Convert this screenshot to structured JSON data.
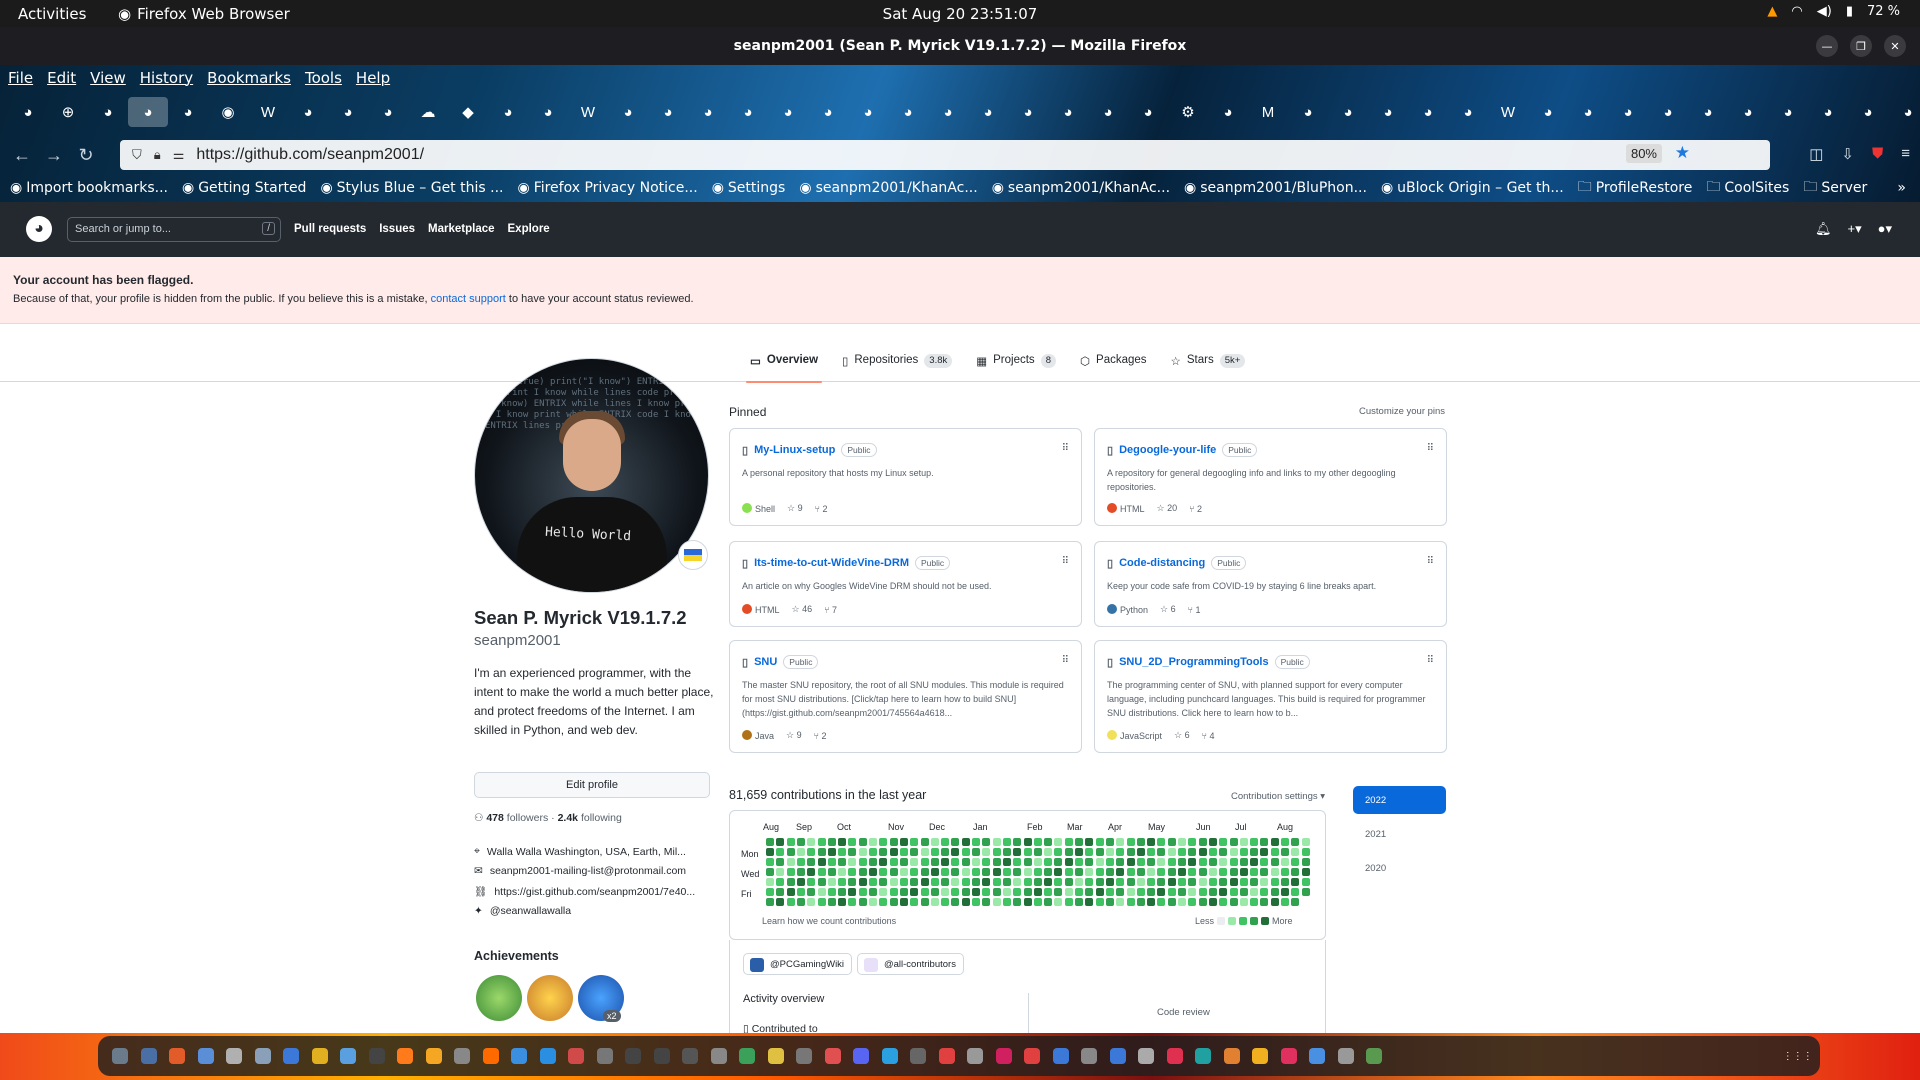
{
  "gnome": {
    "activities": "Activities",
    "app": "Firefox Web Browser",
    "clock": "Sat Aug 20  23:51:07",
    "battery": "72 %"
  },
  "window": {
    "title": "seanpm2001 (Sean P. Myrick V19.1.7.2) — Mozilla Firefox"
  },
  "menu": [
    "File",
    "Edit",
    "View",
    "History",
    "Bookmarks",
    "Tools",
    "Help"
  ],
  "tabs": {
    "count": 48,
    "active_index": 3
  },
  "url": {
    "value": "https://github.com/seanpm2001/",
    "zoom": "80%"
  },
  "bookmarks": [
    "Import bookmarks...",
    "Getting Started",
    "Stylus Blue – Get this ...",
    "Firefox Privacy Notice...",
    "Settings",
    "seanpm2001/KhanAc...",
    "seanpm2001/KhanAc...",
    "seanpm2001/BluPhon...",
    "uBlock Origin – Get th...",
    "ProfileRestore",
    "CoolSites",
    "Server"
  ],
  "github": {
    "search_placeholder": "Search or jump to...",
    "search_key": "/",
    "nav": [
      "Pull requests",
      "Issues",
      "Marketplace",
      "Explore"
    ]
  },
  "flag": {
    "title": "Your account has been flagged.",
    "text_before": "Because of that, your profile is hidden from the public. If you believe this is a mistake,",
    "link": "contact support",
    "text_after": "to have your account status reviewed."
  },
  "profile_tabs": [
    {
      "label": "Overview",
      "count": ""
    },
    {
      "label": "Repositories",
      "count": "3.8k"
    },
    {
      "label": "Projects",
      "count": "8"
    },
    {
      "label": "Packages",
      "count": ""
    },
    {
      "label": "Stars",
      "count": "5k+"
    }
  ],
  "profile": {
    "avatar_text": "Hello World",
    "name": "Sean P. Myrick V19.1.7.2",
    "login": "seanpm2001",
    "bio": "I'm an experienced programmer, with the intent to make the world a much better place, and protect freedoms of the Internet. I am skilled in Python, and web dev.",
    "edit": "Edit profile",
    "followers": "478",
    "followers_label": "followers",
    "following": "2.4k",
    "following_label": "following",
    "location": "Walla Walla Washington, USA, Earth, Mil...",
    "email": "seanpm2001-mailing-list@protonmail.com",
    "website": "https://gist.github.com/seanpm2001/7e40...",
    "twitter": "@seanwallawalla",
    "achievements_title": "Achievements",
    "achievement_multiplier": "x2"
  },
  "pinned": {
    "title": "Pinned",
    "customize": "Customize your pins",
    "cards": [
      {
        "name": "My-Linux-setup",
        "vis": "Public",
        "desc": "A personal repository that hosts my Linux setup.",
        "lang": "Shell",
        "color": "#89e051",
        "stars": "9",
        "forks": "2"
      },
      {
        "name": "Degoogle-your-life",
        "vis": "Public",
        "desc": "A repository for general degoogling info and links to my other degoogling repositories.",
        "lang": "HTML",
        "color": "#e34c26",
        "stars": "20",
        "forks": "2"
      },
      {
        "name": "Its-time-to-cut-WideVine-DRM",
        "vis": "Public",
        "desc": "An article on why Googles WideVine DRM should not be used.",
        "lang": "HTML",
        "color": "#e34c26",
        "stars": "46",
        "forks": "7"
      },
      {
        "name": "Code-distancing",
        "vis": "Public",
        "desc": "Keep your code safe from COVID-19 by staying 6 line breaks apart.",
        "lang": "Python",
        "color": "#3572A5",
        "stars": "6",
        "forks": "1"
      },
      {
        "name": "SNU",
        "vis": "Public",
        "desc": "The master SNU repository, the root of all SNU modules. This module is required for most SNU distributions. [Click/tap here to learn how to build SNU](https://gist.github.com/seanpm2001/745564a4618...",
        "lang": "Java",
        "color": "#b07219",
        "stars": "9",
        "forks": "2"
      },
      {
        "name": "SNU_2D_ProgrammingTools",
        "vis": "Public",
        "desc": "The programming center of SNU, with planned support for every computer language, including punchcard languages. This build is required for programmer SNU distributions. Click here to learn how to b...",
        "lang": "JavaScript",
        "color": "#f1e05a",
        "stars": "6",
        "forks": "4"
      }
    ]
  },
  "contributions": {
    "title": "81,659 contributions in the last year",
    "settings": "Contribution settings ▾",
    "months": [
      "Aug",
      "Sep",
      "Oct",
      "Nov",
      "Dec",
      "Jan",
      "Feb",
      "Mar",
      "Apr",
      "May",
      "Jun",
      "Jul",
      "Aug"
    ],
    "days": [
      "Mon",
      "Wed",
      "Fri"
    ],
    "learn": "Learn how we count contributions",
    "less": "Less",
    "more": "More",
    "years": [
      "2022",
      "2021",
      "2020"
    ]
  },
  "orgs": [
    "@PCGamingWiki",
    "@all-contributors"
  ],
  "activity": {
    "title": "Activity overview",
    "contributed": "Contributed to",
    "code_review": "Code review"
  }
}
